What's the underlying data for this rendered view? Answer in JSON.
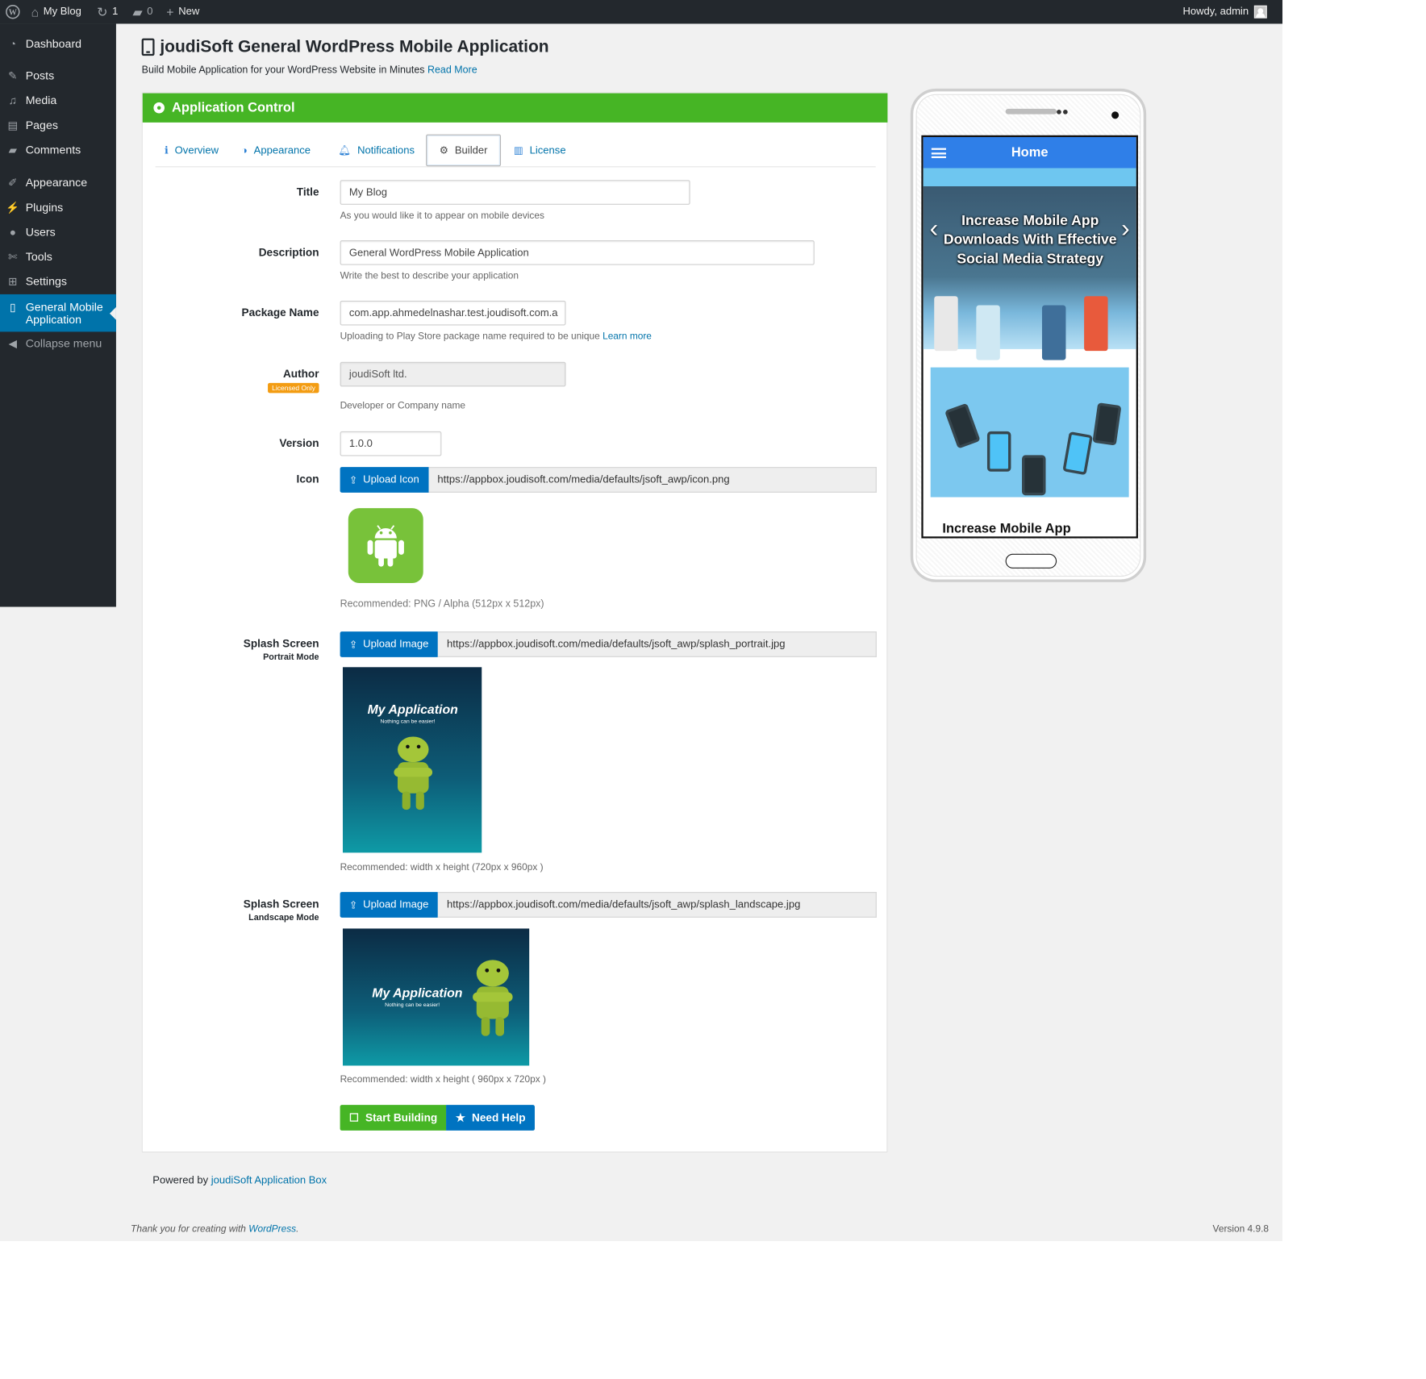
{
  "colors": {
    "accent": "#46b525",
    "link": "#0073aa",
    "button_blue": "#0073c1",
    "admin_bar": "#23282d",
    "phone_bar": "#2f7fe8",
    "badge": "#f39c12"
  },
  "admin_bar": {
    "site_name": "My Blog",
    "updates_count": "1",
    "comments_count": "0",
    "new_label": "New",
    "howdy": "Howdy, admin",
    "icons": [
      "wordpress-logo-icon",
      "home-icon",
      "updates-icon",
      "comments-icon",
      "plus-icon",
      "avatar"
    ]
  },
  "menu": {
    "items": [
      {
        "label": "Dashboard",
        "icon": "dashboard-icon"
      },
      {
        "label": "Posts",
        "icon": "pin-icon"
      },
      {
        "label": "Media",
        "icon": "media-icon"
      },
      {
        "label": "Pages",
        "icon": "page-icon"
      },
      {
        "label": "Comments",
        "icon": "comment-icon"
      },
      {
        "label": "Appearance",
        "icon": "brush-icon"
      },
      {
        "label": "Plugins",
        "icon": "plugin-icon"
      },
      {
        "label": "Users",
        "icon": "user-icon"
      },
      {
        "label": "Tools",
        "icon": "wrench-icon"
      },
      {
        "label": "Settings",
        "icon": "settings-icon"
      },
      {
        "label": "General Mobile Application",
        "icon": "tablet-icon"
      }
    ],
    "collapse_label": "Collapse menu"
  },
  "page": {
    "title": "joudiSoft General WordPress Mobile Application",
    "subtitle": "Build Mobile Application for your WordPress Website in Minutes",
    "read_more": "Read More"
  },
  "panel": {
    "title": "Application Control",
    "tabs": [
      {
        "label": "Overview",
        "icon": "info-icon"
      },
      {
        "label": "Appearance",
        "icon": "contrast-icon"
      },
      {
        "label": "Notifications",
        "icon": "bell-icon"
      },
      {
        "label": "Builder",
        "icon": "cogs-icon",
        "active": true
      },
      {
        "label": "License",
        "icon": "barcode-icon"
      }
    ]
  },
  "form": {
    "title": {
      "label": "Title",
      "value": "My Blog",
      "help": "As you would like it to appear on mobile devices"
    },
    "description": {
      "label": "Description",
      "value": "General WordPress Mobile Application",
      "help": "Write the best to describe your application"
    },
    "package": {
      "label": "Package Name",
      "value": "com.app.ahmedelnashar.test.joudisoft.com.a",
      "help": "Uploading to Play Store package name required to be unique",
      "help_link": "Learn more"
    },
    "author": {
      "label": "Author",
      "badge": "Licensed Only",
      "value": "joudiSoft ltd.",
      "help": "Developer or Company name"
    },
    "version": {
      "label": "Version",
      "value": "1.0.0"
    },
    "icon": {
      "label": "Icon",
      "button": "Upload Icon",
      "url": "https://appbox.joudisoft.com/media/defaults/jsoft_awp/icon.png",
      "help": "Recommended: PNG / Alpha (512px x 512px)"
    },
    "splash_portrait": {
      "label": "Splash Screen",
      "sublabel": "Portrait Mode",
      "button": "Upload Image",
      "url": "https://appbox.joudisoft.com/media/defaults/jsoft_awp/splash_portrait.jpg",
      "help": "Recommended: width x height (720px x 960px )",
      "preview_title": "My Application",
      "preview_sub": "Nothing can be easier!"
    },
    "splash_landscape": {
      "label": "Splash Screen",
      "sublabel": "Landscape Mode",
      "button": "Upload Image",
      "url": "https://appbox.joudisoft.com/media/defaults/jsoft_awp/splash_landscape.jpg",
      "help": "Recommended: width x height ( 960px x 720px )",
      "preview_title": "My Application",
      "preview_sub": "Nothing can be easier!"
    }
  },
  "actions": {
    "start": "Start Building",
    "help": "Need Help"
  },
  "powered": {
    "prefix": "Powered by",
    "link": "joudiSoft Application Box"
  },
  "footer": {
    "thanks": "Thank you for creating with",
    "wp_link": "WordPress",
    "period": ".",
    "version": "Version 4.9.8"
  },
  "phone": {
    "bar_title": "Home",
    "slide_title": "Increase Mobile App Downloads With Effective Social Media Strategy",
    "card_title": "Increase Mobile App"
  }
}
